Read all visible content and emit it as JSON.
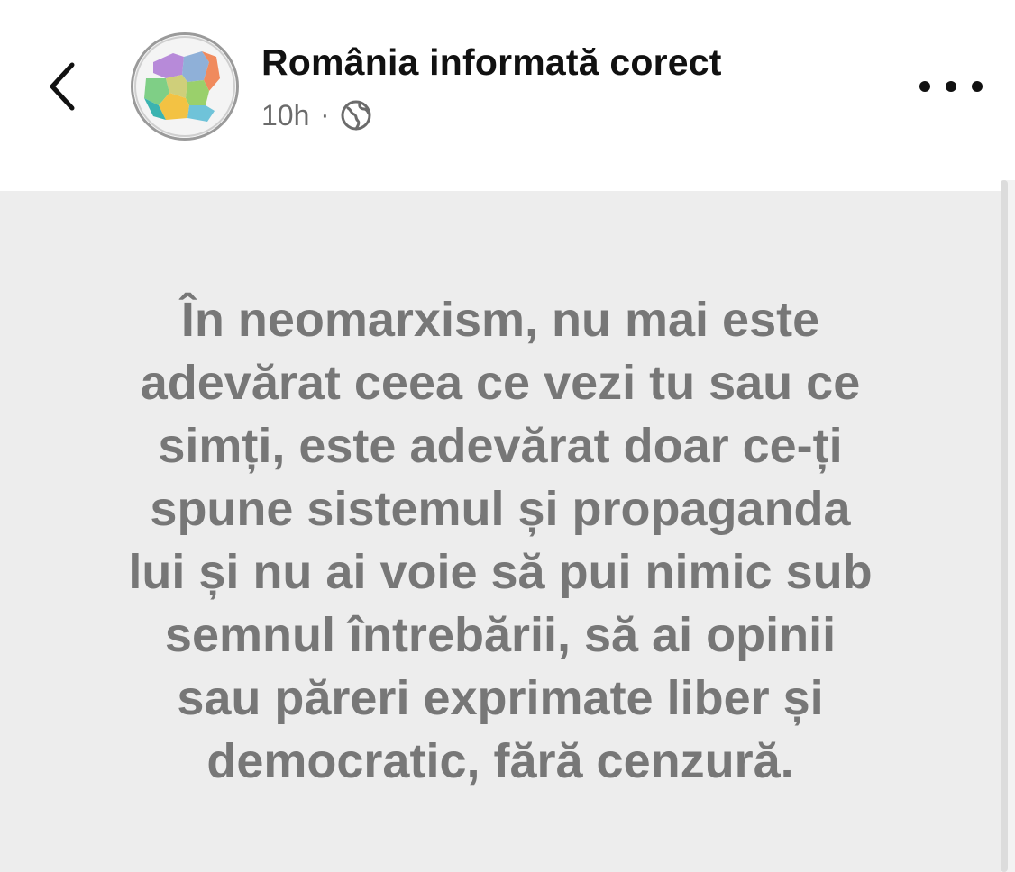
{
  "header": {
    "back_icon": "chevron-left-icon",
    "page_name": "România informată corect",
    "time_ago": "10h",
    "separator": "·",
    "audience_icon": "globe-icon",
    "more_icon": "more-horizontal-icon"
  },
  "post": {
    "background_color": "#ededed",
    "text_color": "#777777",
    "lines": [
      "În neomarxism, nu mai este",
      "adevărat ceea ce vezi tu sau ce",
      "simți, este adevărat doar ce-ți",
      "spune sistemul și propaganda",
      "lui și nu ai voie să pui nimic sub",
      "semnul întrebării, să ai opinii",
      "sau păreri exprimate liber și",
      "democratic, fără cenzură."
    ]
  }
}
